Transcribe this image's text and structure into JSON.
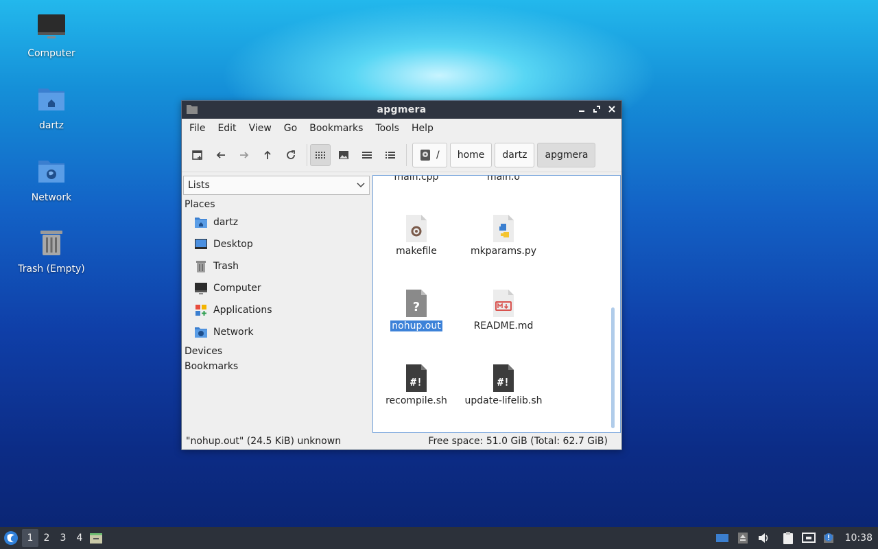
{
  "desktop": {
    "icons": [
      {
        "label": "Computer",
        "icon": "computer-icon"
      },
      {
        "label": "dartz",
        "icon": "home-folder-icon"
      },
      {
        "label": "Network",
        "icon": "network-folder-icon"
      },
      {
        "label": "Trash (Empty)",
        "icon": "trash-icon"
      }
    ]
  },
  "window": {
    "title": "apgmera",
    "menu": [
      "File",
      "Edit",
      "View",
      "Go",
      "Bookmarks",
      "Tools",
      "Help"
    ],
    "breadcrumbs": [
      "/",
      "home",
      "dartz",
      "apgmera"
    ],
    "sidebar": {
      "mode": "Lists",
      "places_header": "Places",
      "places": [
        {
          "label": "dartz",
          "icon": "home-folder-icon"
        },
        {
          "label": "Desktop",
          "icon": "desktop-icon"
        },
        {
          "label": "Trash",
          "icon": "trash-icon"
        },
        {
          "label": "Computer",
          "icon": "computer-icon"
        },
        {
          "label": "Applications",
          "icon": "applications-icon"
        },
        {
          "label": "Network",
          "icon": "network-folder-icon"
        }
      ],
      "devices_header": "Devices",
      "bookmarks_header": "Bookmarks"
    },
    "files": [
      {
        "name": "main.cpp",
        "icon": "file-icon",
        "selected": false
      },
      {
        "name": "main.o",
        "icon": "file-icon",
        "selected": false
      },
      {
        "name": "makefile",
        "icon": "makefile-icon",
        "selected": false
      },
      {
        "name": "mkparams.py",
        "icon": "python-icon",
        "selected": false
      },
      {
        "name": "nohup.out",
        "icon": "unknown-file-icon",
        "selected": true
      },
      {
        "name": "README.md",
        "icon": "markdown-icon",
        "selected": false
      },
      {
        "name": "recompile.sh",
        "icon": "shell-script-icon",
        "selected": false
      },
      {
        "name": "update-lifelib.sh",
        "icon": "shell-script-icon",
        "selected": false
      }
    ],
    "status": {
      "selection": "\"nohup.out\" (24.5 KiB) unknown",
      "free_space": "Free space: 51.0 GiB (Total: 62.7 GiB)"
    }
  },
  "taskbar": {
    "desktops": [
      "1",
      "2",
      "3",
      "4"
    ],
    "active_desktop": "1",
    "clock": "10:38"
  },
  "colors": {
    "selection": "#3d82d8",
    "titlebar": "#2e3440",
    "taskbar": "#2c313a"
  }
}
